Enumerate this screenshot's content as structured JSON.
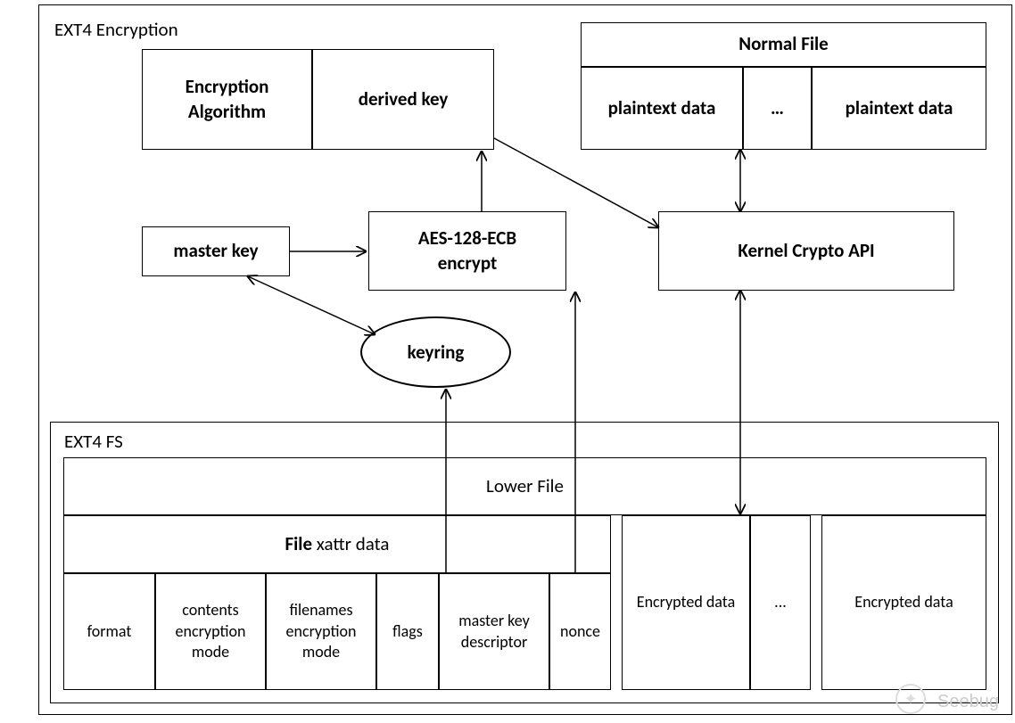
{
  "titles": {
    "main": "EXT4 Encryption",
    "fs": "EXT4 FS"
  },
  "upper_left": {
    "enc_alg": "Encryption",
    "enc_alg2": "Algorithm",
    "derived_key": "derived key"
  },
  "normal_file": {
    "header": "Normal File",
    "cells": [
      "plaintext data",
      "…",
      "plaintext data"
    ]
  },
  "master_key": "master key",
  "aes": {
    "l1": "AES-128-ECB",
    "l2": "encrypt"
  },
  "keyring": "keyring",
  "kernel_crypto": "Kernel Crypto API",
  "lower_file": {
    "header": "Lower File",
    "xattr_label_bold": "File",
    "xattr_label_rest": " xattr data",
    "fields": [
      "format",
      "contents encryption mode",
      "filenames encryption mode",
      "flags",
      "master key descriptor",
      "nonce"
    ],
    "tail": [
      "Encrypted data",
      "...",
      "Encrypted data"
    ]
  },
  "watermark": "Seebug"
}
